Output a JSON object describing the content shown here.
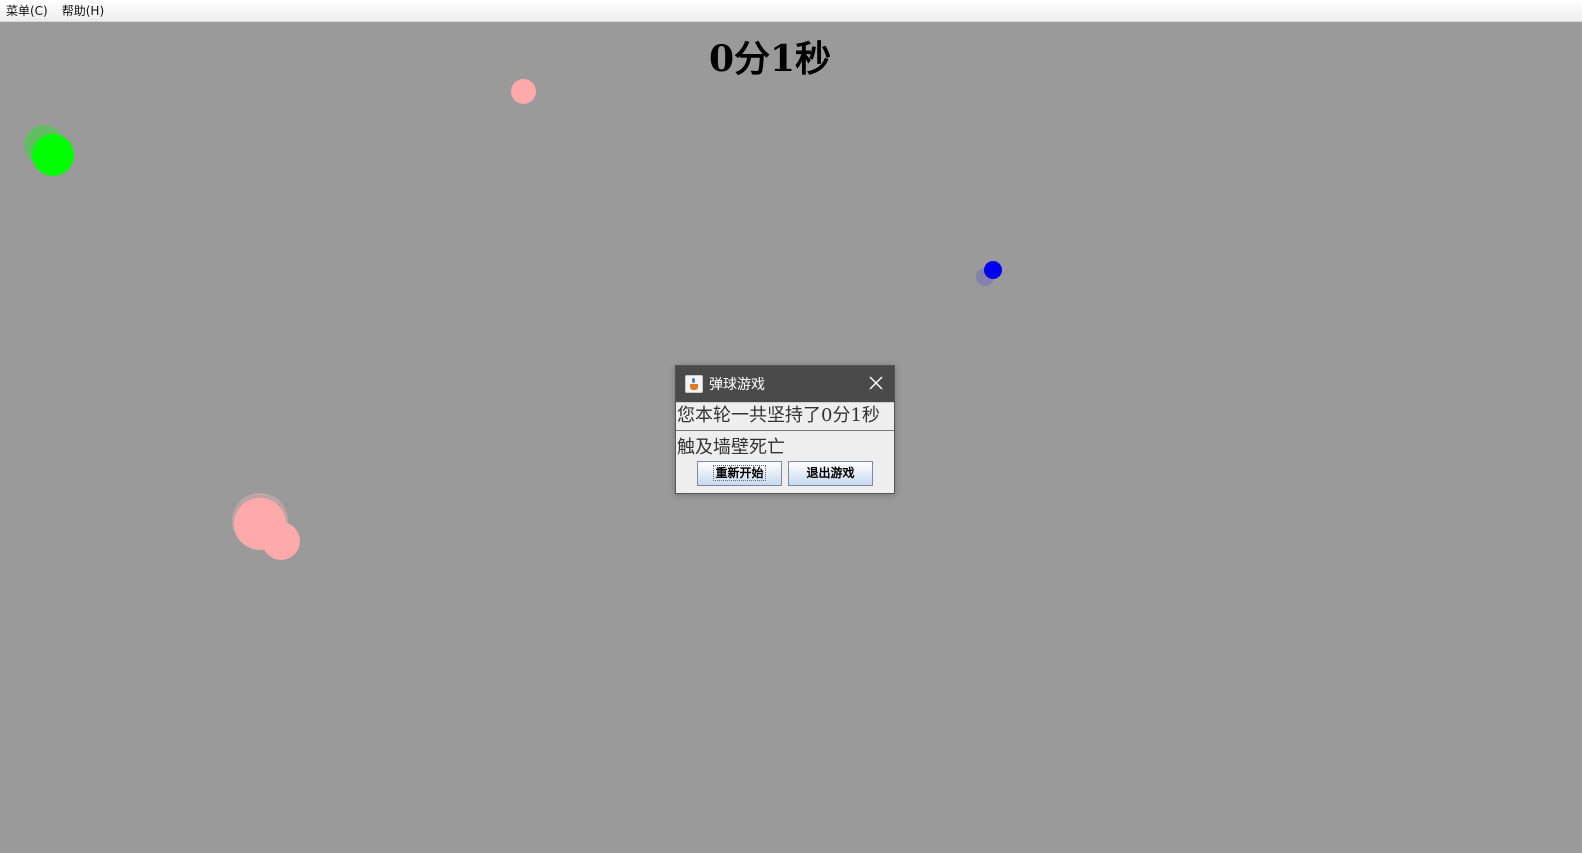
{
  "menubar": {
    "items": [
      {
        "label": "菜单(C)"
      },
      {
        "label": "帮助(H)"
      }
    ]
  },
  "game": {
    "timer_text": "0分1秒",
    "background_color": "#9a9a9a",
    "ball_colors": {
      "green": "#00ff00",
      "pink": "#ffaaaa",
      "blue": "#0000ee"
    }
  },
  "dialog": {
    "title": "弹球游戏",
    "message_line1": "您本轮一共坚持了0分1秒",
    "message_line2": "触及墙壁死亡",
    "restart_label": "重新开始",
    "exit_label": "退出游戏",
    "close_icon": "close-icon",
    "app_icon": "java-cup-icon"
  }
}
